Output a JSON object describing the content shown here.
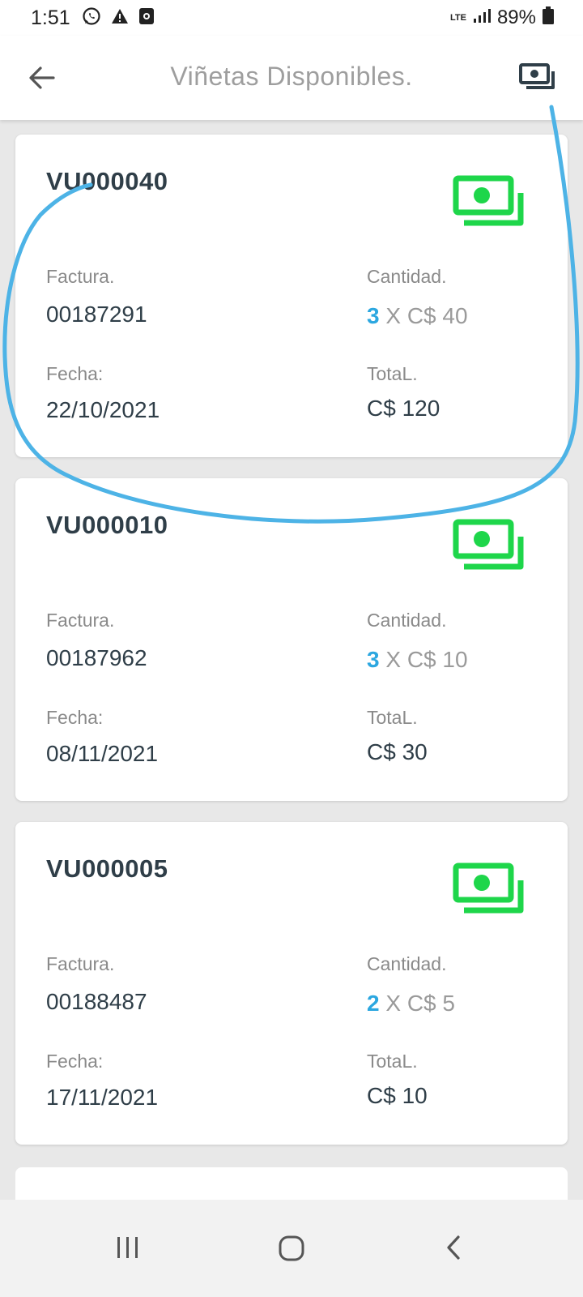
{
  "status_bar": {
    "time": "1:51",
    "network": "LTE",
    "battery": "89%",
    "icons": [
      "whatsapp-icon",
      "warning-icon",
      "media-icon",
      "signal-icon",
      "battery-icon"
    ]
  },
  "app_bar": {
    "title": "Viñetas Disponibles.",
    "back_icon": "back-arrow-icon",
    "action_icon": "money-stack-icon"
  },
  "labels": {
    "factura": "Factura.",
    "cantidad": "Cantidad.",
    "fecha": "Fecha:",
    "total": "TotaL."
  },
  "cards": [
    {
      "code": "VU000040",
      "factura": "00187291",
      "qty": "3",
      "qty_rest": " X C$ 40",
      "fecha": "22/10/2021",
      "total": "C$ 120"
    },
    {
      "code": "VU000010",
      "factura": "00187962",
      "qty": "3",
      "qty_rest": " X C$ 10",
      "fecha": "08/11/2021",
      "total": "C$ 30"
    },
    {
      "code": "VU000005",
      "factura": "00188487",
      "qty": "2",
      "qty_rest": " X C$ 5",
      "fecha": "17/11/2021",
      "total": "C$ 10"
    }
  ],
  "colors": {
    "money_icon": "#1ed64a",
    "qty_accent": "#2ca7e0",
    "annotation": "#4db3e6"
  },
  "nav_bar": {
    "icons": [
      "recents-icon",
      "home-icon",
      "nav-back-icon"
    ]
  }
}
